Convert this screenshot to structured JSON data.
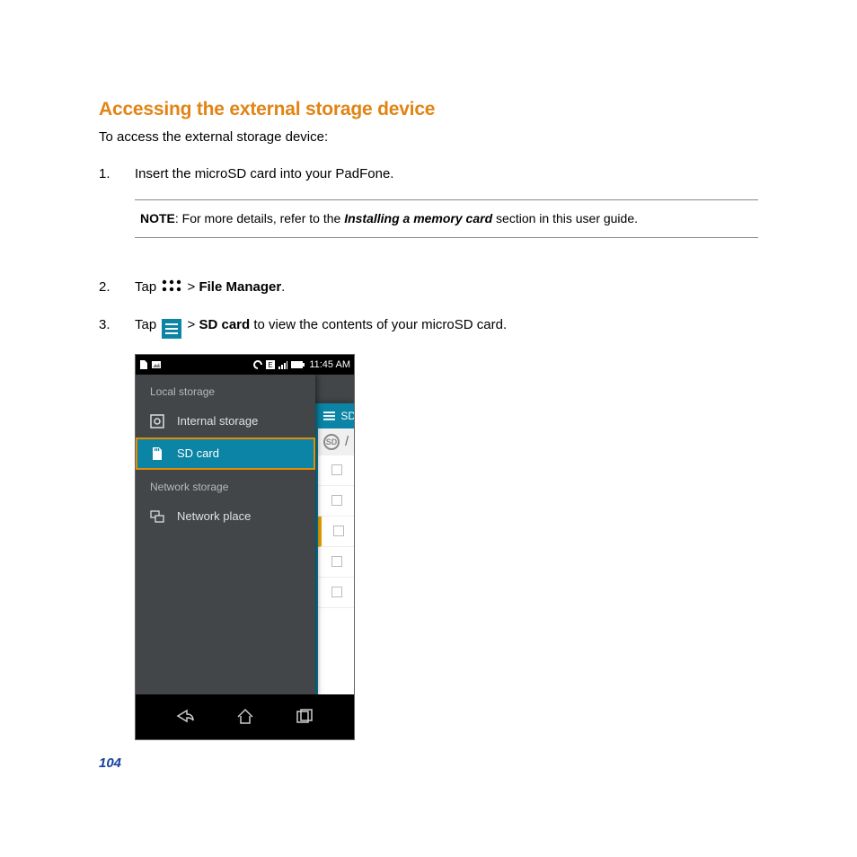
{
  "heading": "Accessing the external storage device",
  "intro": "To access the external storage device:",
  "steps": {
    "s1_num": "1.",
    "s1_text": "Insert the microSD card into your PadFone.",
    "s2_num": "2.",
    "s2_a": "Tap ",
    "s2_b": " > ",
    "s2_c": "File Manager",
    "s2_d": ".",
    "s3_num": "3.",
    "s3_a": "Tap ",
    "s3_b": "  > ",
    "s3_c": "SD card",
    "s3_d": " to view the contents of your microSD card."
  },
  "note": {
    "label": "NOTE",
    "sep": ": For more details, refer to the ",
    "em": "Installing a memory card",
    "tail": " section in this user guide."
  },
  "phone": {
    "time": "11:45 AM",
    "drawer": {
      "section1": "Local storage",
      "item1": "Internal storage",
      "item2": "SD card",
      "section2": "Network storage",
      "item3": "Network place"
    },
    "overlay_title": "SD",
    "overlay_crumb": "/"
  },
  "page_num": "104"
}
